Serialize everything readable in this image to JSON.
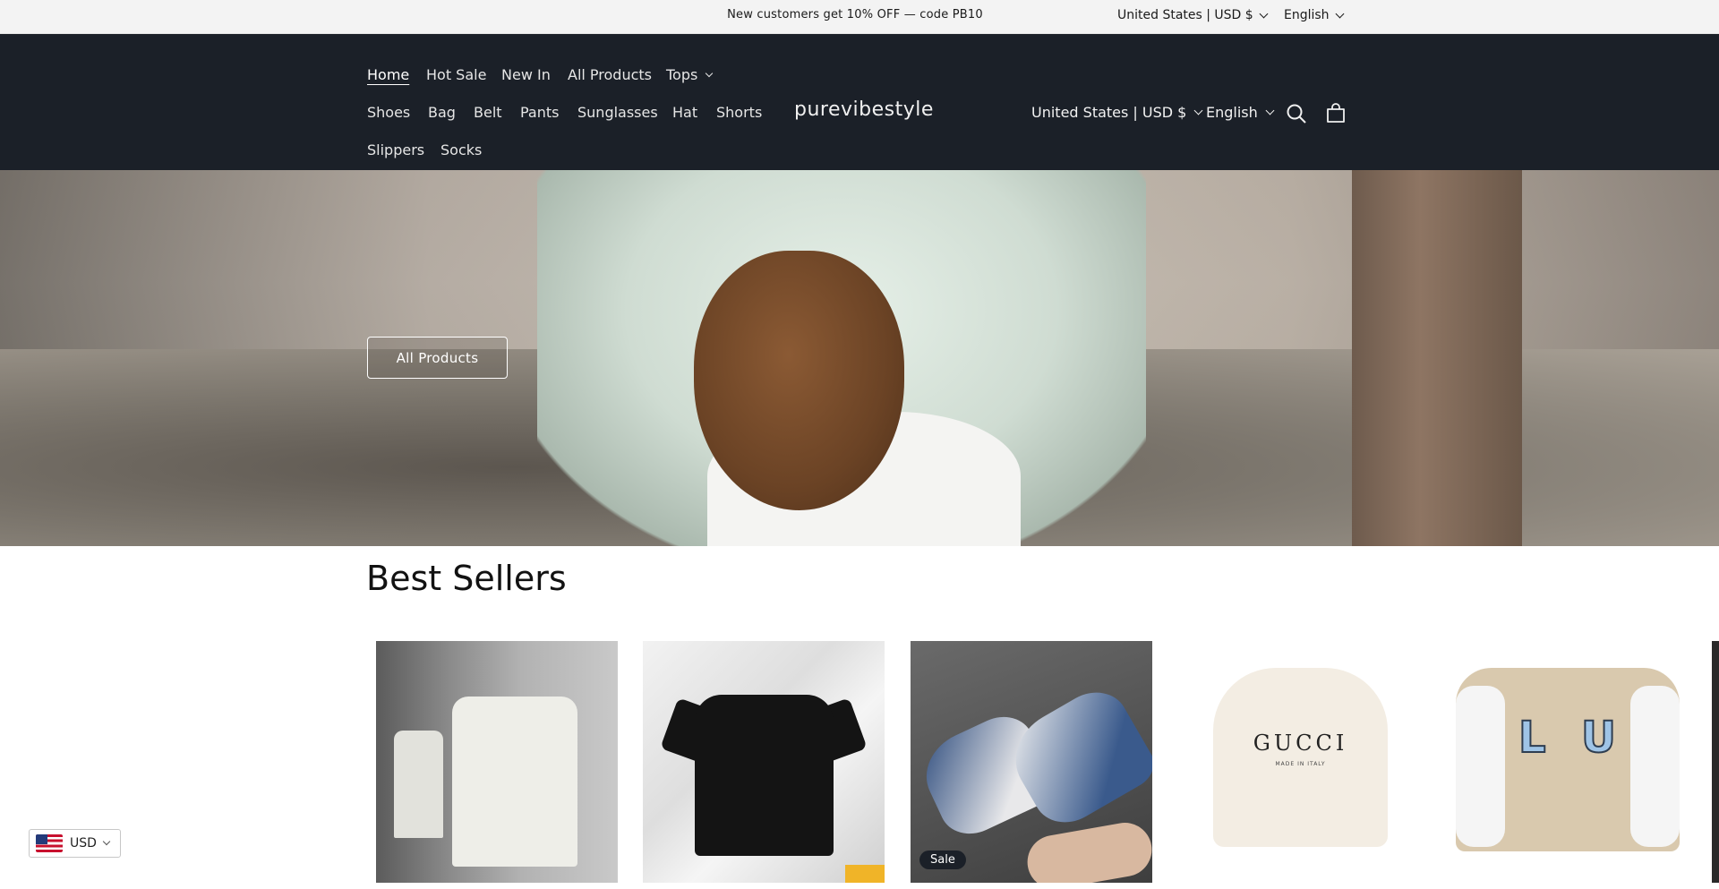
{
  "announcement": {
    "text": "New customers get 10% OFF — code  PB10",
    "country_selector": "United States | USD $",
    "language_selector": "English"
  },
  "header": {
    "logo": "purevibestyle",
    "nav": [
      "Home",
      "Hot Sale",
      "New In",
      "All Products",
      "Tops",
      "Shoes",
      "Bag",
      "Belt",
      "Pants",
      "Sunglasses",
      "Hat",
      "Shorts",
      "Slippers",
      "Socks"
    ],
    "active_nav": "Home",
    "country_selector": "United States | USD $",
    "language_selector": "English",
    "icons": [
      "search-icon",
      "cart-icon"
    ]
  },
  "hero": {
    "button_label": "All Products"
  },
  "best_sellers": {
    "title": "Best Sellers",
    "products": [
      {
        "badge": ""
      },
      {
        "badge": ""
      },
      {
        "badge": "Sale"
      },
      {
        "badge": "",
        "print": "GUCCI",
        "print_sub": "MADE IN ITALY"
      },
      {
        "badge": ""
      }
    ]
  },
  "currency_widget": {
    "code": "USD",
    "flag": "us-flag-icon"
  },
  "colors": {
    "header_bg": "#1b2028",
    "announcement_bg": "#f3f3f3",
    "text": "#121212"
  }
}
